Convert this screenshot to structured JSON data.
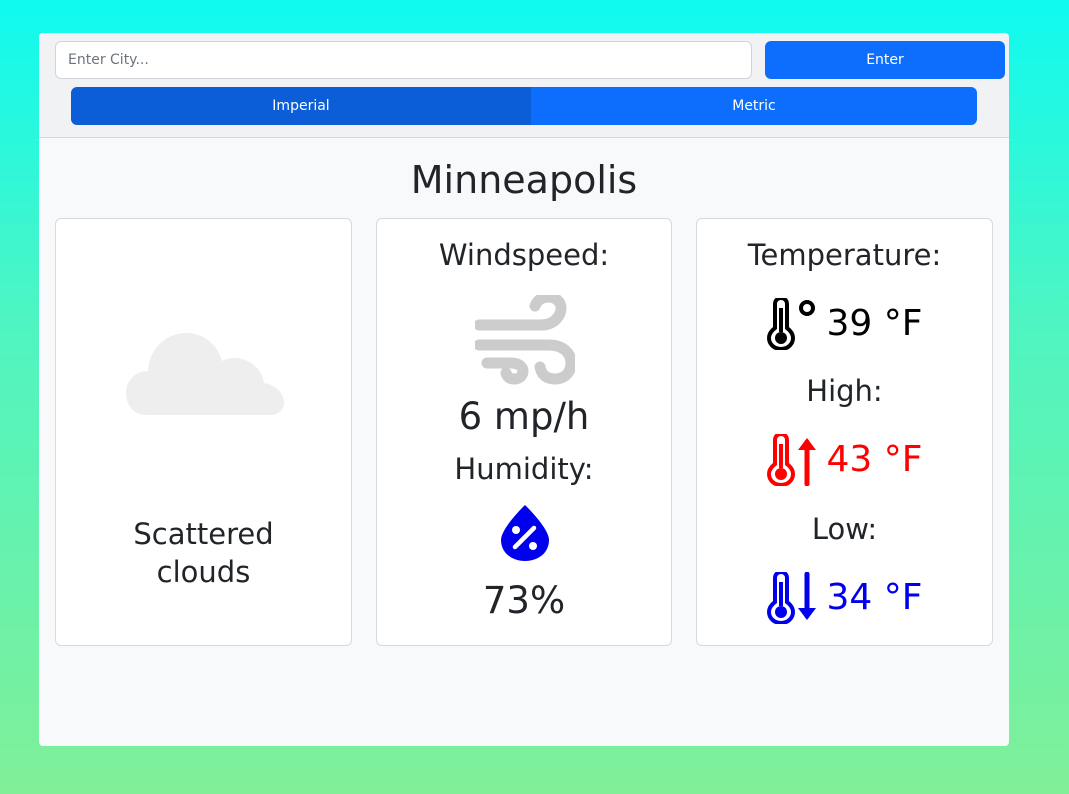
{
  "search": {
    "placeholder": "Enter City...",
    "value": "",
    "enter_label": "Enter"
  },
  "units": {
    "imperial_label": "Imperial",
    "metric_label": "Metric",
    "selected": "Imperial"
  },
  "city": "Minneapolis",
  "condition": {
    "icon": "cloud-icon",
    "description_line1": "Scattered",
    "description_line2": "clouds"
  },
  "wind": {
    "label": "Windspeed:",
    "icon": "wind-icon",
    "value": "6 mp/h"
  },
  "humidity": {
    "label": "Humidity:",
    "icon": "humidity-droplet-icon",
    "value": "73%"
  },
  "temperature": {
    "label": "Temperature:",
    "icon": "thermometer-icon",
    "value": "39 °F",
    "high_label": "High:",
    "high_icon": "thermometer-up-icon",
    "high_value": "43 °F",
    "low_label": "Low:",
    "low_icon": "thermometer-down-icon",
    "low_value": "34 °F"
  },
  "colors": {
    "primary": "#0d6efd",
    "primary_active": "#0b5ed7",
    "high": "#ff0000",
    "low": "#0000ee",
    "humidity_icon": "#0000ee"
  }
}
